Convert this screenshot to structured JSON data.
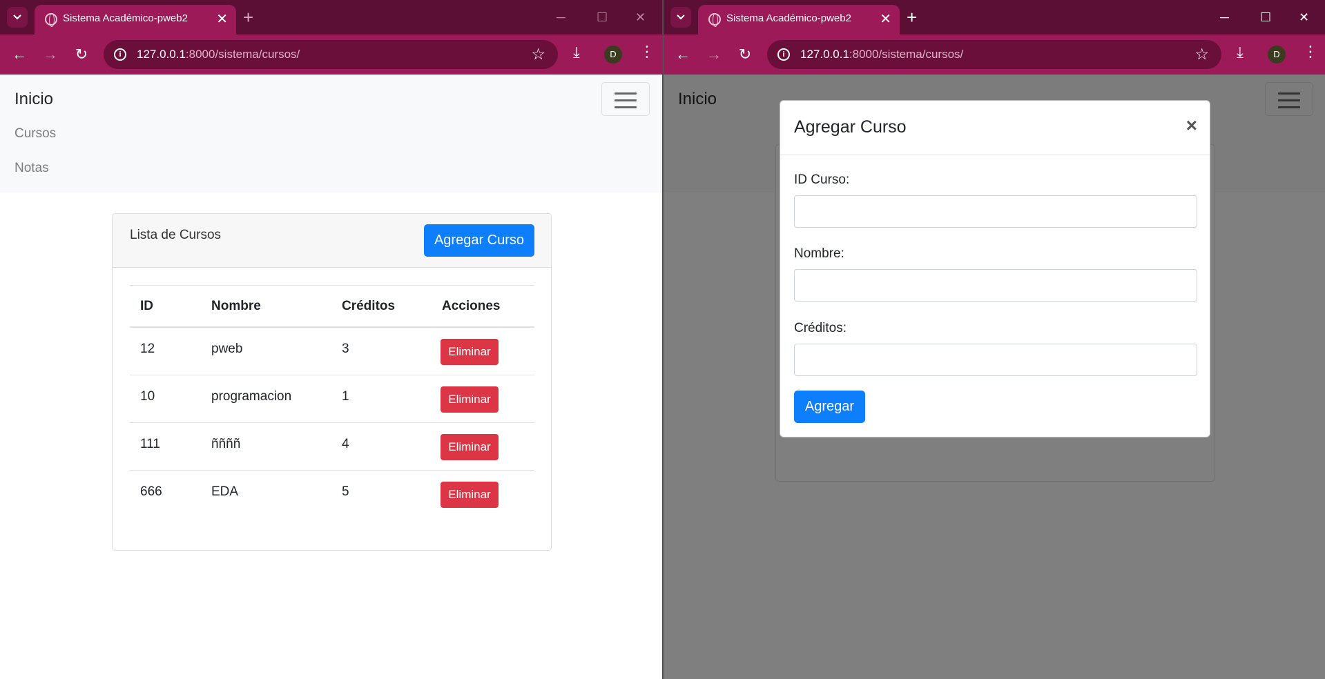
{
  "browser": {
    "tab_title": "Sistema Académico-pweb2",
    "url_host": "127.0.0.1",
    "url_rest": ":8000/sistema/cursos/",
    "avatar_letter": "D"
  },
  "navbar": {
    "brand": "Inicio",
    "links": [
      "Cursos",
      "Notas"
    ]
  },
  "card": {
    "title": "Lista de Cursos",
    "add_button": "Agregar Curso",
    "columns": [
      "ID",
      "Nombre",
      "Créditos",
      "Acciones"
    ],
    "rows": [
      {
        "id": "12",
        "nombre": "pweb",
        "creditos": "3",
        "action": "Eliminar"
      },
      {
        "id": "10",
        "nombre": "programacion",
        "creditos": "1",
        "action": "Eliminar"
      },
      {
        "id": "111",
        "nombre": "ññññ",
        "creditos": "4",
        "action": "Eliminar"
      },
      {
        "id": "666",
        "nombre": "EDA",
        "creditos": "5",
        "action": "Eliminar"
      }
    ]
  },
  "modal": {
    "title": "Agregar Curso",
    "close": "×",
    "fields": [
      {
        "label": "ID Curso:",
        "value": ""
      },
      {
        "label": "Nombre:",
        "value": ""
      },
      {
        "label": "Créditos:",
        "value": ""
      }
    ],
    "submit": "Agregar"
  },
  "colors": {
    "chrome_dark": "#5c0f34",
    "chrome_toolbar": "#9b1a57",
    "primary": "#0d7efc",
    "danger": "#dc3545"
  }
}
